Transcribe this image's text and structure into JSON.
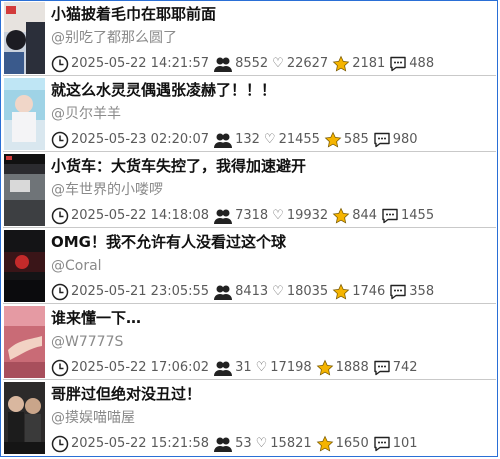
{
  "videos": [
    {
      "title": "小猫披着毛巾在耶耶前面",
      "author": "@别吃了都那么圆了",
      "date": "2025-05-22 14:21:57",
      "plays": "8552",
      "likes": "22627",
      "favs": "2181",
      "comments": "488"
    },
    {
      "title": "就这么水灵灵偶遇张凌赫了！！！",
      "author": "@贝尔羊羊",
      "date": "2025-05-23 02:20:07",
      "plays": "132",
      "likes": "21455",
      "favs": "585",
      "comments": "980"
    },
    {
      "title": "小货车：大货车失控了，我得加速避开",
      "author": "@车世界的小喽啰",
      "date": "2025-05-22 14:18:08",
      "plays": "7318",
      "likes": "19932",
      "favs": "844",
      "comments": "1455"
    },
    {
      "title": "OMG！我不允许有人没看过这个球",
      "author": "@Coral",
      "date": "2025-05-21 23:05:55",
      "plays": "8413",
      "likes": "18035",
      "favs": "1746",
      "comments": "358"
    },
    {
      "title": "谁来懂一下…",
      "author": "@W7777S",
      "date": "2025-05-22 17:06:02",
      "plays": "31",
      "likes": "17198",
      "favs": "1888",
      "comments": "742"
    },
    {
      "title": "哥胖过但绝对没丑过！",
      "author": "@摸娱喵喵屋",
      "date": "2025-05-22 15:21:58",
      "plays": "53",
      "likes": "15821",
      "favs": "1650",
      "comments": "101"
    }
  ],
  "icons": {
    "time": "clock-icon",
    "plays": "people-icon",
    "likes": "heart-icon",
    "favs": "star-icon",
    "comments": "comment-icon"
  },
  "colors": {
    "border": "#2a6fd6",
    "star": "#f5b400"
  }
}
